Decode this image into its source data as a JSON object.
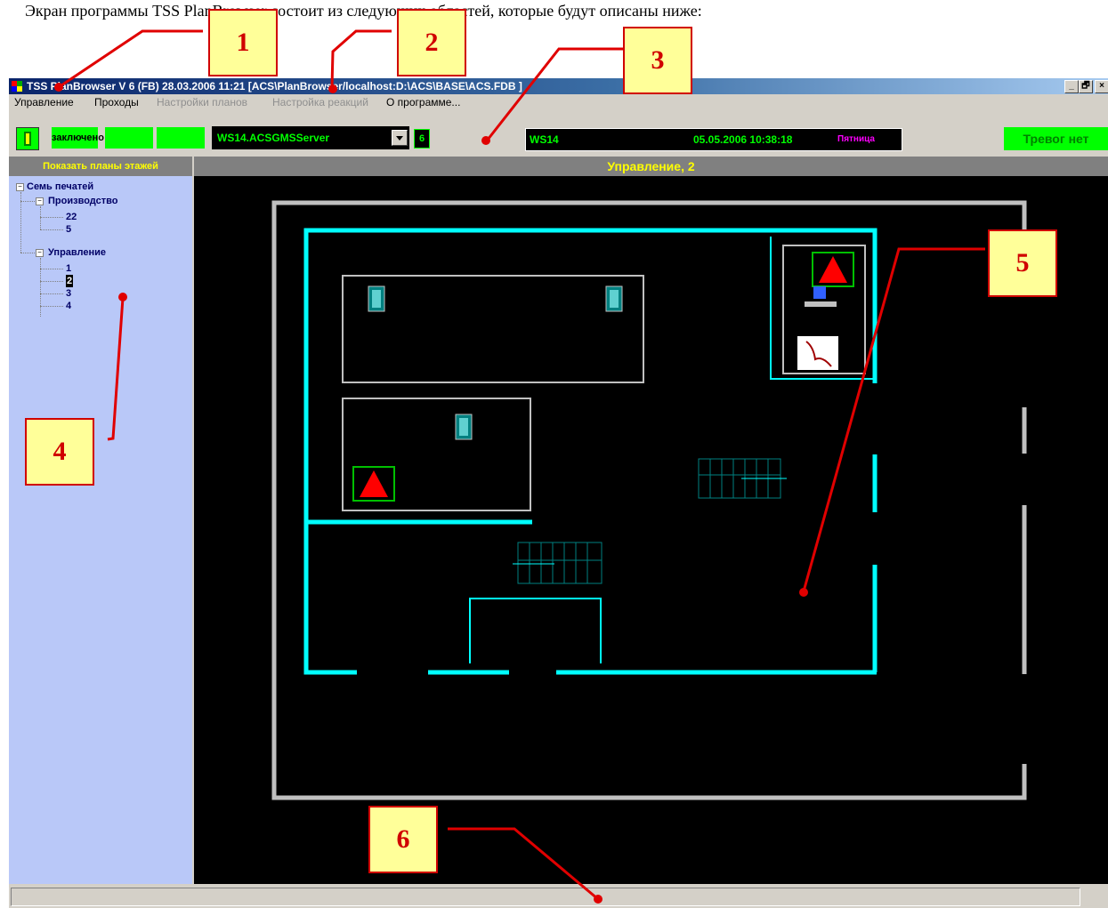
{
  "doc_text": "Экран программы TSS PlanBrowser состоит из следующих областей, которые будут описаны ниже:",
  "window": {
    "title": "TSS PlanBrowser V 6 (FB) 28.03.2006 11:21 [ACS\\PlanBrowser/localhost:D:\\ACS\\BASE\\ACS.FDB ]",
    "minimize": "_",
    "maximize": "🗗",
    "close": "×"
  },
  "menu": [
    {
      "label": "Управление",
      "enabled": true
    },
    {
      "label": "Проходы",
      "enabled": true
    },
    {
      "label": "Настройки планов",
      "enabled": false
    },
    {
      "label": "Настройка реакций",
      "enabled": false
    },
    {
      "label": "О программе...",
      "enabled": true
    }
  ],
  "toolbar": {
    "lock_status": "заключено",
    "server": "WS14.ACSGMSServer",
    "server_num": "6",
    "ws_name": "WS14",
    "datetime": "05.05.2006 10:38:18",
    "weekday": "Пятница",
    "alarm": "Тревог нет"
  },
  "sidebar": {
    "header": "Показать планы этажей",
    "root": "Семь печатей",
    "groups": [
      {
        "label": "Производство",
        "items": [
          "22",
          "5"
        ]
      },
      {
        "label": "Управление",
        "items": [
          "1",
          "2",
          "3",
          "4"
        ],
        "selected": "2"
      }
    ]
  },
  "plan": {
    "header": "Управление, 2",
    "colors": {
      "wall": "#00ffff",
      "outer": "#c0c0c0",
      "bg": "#000000",
      "alarm": "#ff0000"
    }
  },
  "callouts": [
    "1",
    "2",
    "3",
    "4",
    "5",
    "6"
  ]
}
